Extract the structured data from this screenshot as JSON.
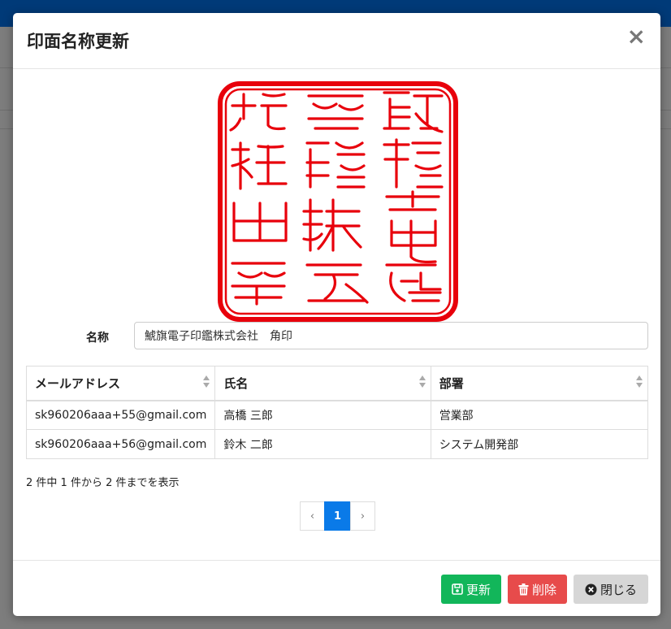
{
  "modal": {
    "title": "印面名称更新",
    "close_symbol": "×"
  },
  "seal": {
    "color": "#e8000b",
    "text": "鯱旗電子印鑑株式会社"
  },
  "form": {
    "name_label": "名称",
    "name_value": "鯱旗電子印鑑株式会社　角印"
  },
  "table": {
    "headers": [
      "メールアドレス",
      "氏名",
      "部署"
    ],
    "rows": [
      [
        "sk960206aaa+55@gmail.com",
        "高橋 三郎",
        "営業部"
      ],
      [
        "sk960206aaa+56@gmail.com",
        "鈴木 二郎",
        "システム開発部"
      ]
    ]
  },
  "info_text": "2 件中 1 件から 2 件までを表示",
  "pagination": {
    "prev": "‹",
    "current": "1",
    "next": "›"
  },
  "footer": {
    "update_label": "更新",
    "delete_label": "削除",
    "close_label": "閉じる"
  },
  "colors": {
    "update": "#12b65a",
    "delete": "#e74b4b",
    "close": "#d6d6d6",
    "pager_active": "#0a7ae8"
  }
}
